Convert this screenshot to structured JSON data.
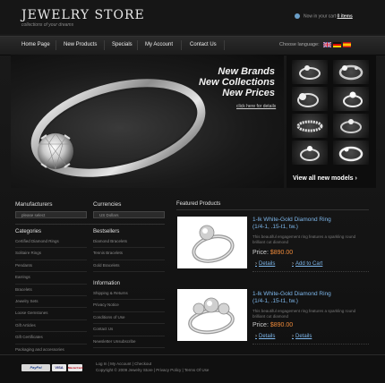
{
  "header": {
    "logo_title": "JEWELRY STORE",
    "logo_subtitle": "collections of your dreams",
    "cart_text": "Now in your cart ",
    "cart_items": "0 items"
  },
  "nav": {
    "items": [
      "Home Page",
      "New Products",
      "Specials",
      "My Account",
      "Contact Us"
    ],
    "language_label": "Choose language:",
    "flags": [
      "uk-flag-icon",
      "de-flag-icon",
      "es-flag-icon"
    ]
  },
  "banner": {
    "lines": [
      "New Brands",
      "New Collections",
      "New Prices"
    ],
    "link": "click here for details"
  },
  "gallery": {
    "view_all": "View all new models",
    "arrow": "›"
  },
  "sidebar": {
    "manufacturers": {
      "title": "Manufacturers",
      "select": "please select"
    },
    "currencies": {
      "title": "Currencies",
      "select": "US Dollars"
    },
    "categories": {
      "title": "Categories",
      "items": [
        "Certified Diamond Rings",
        "Solitaire Rings",
        "Pendants",
        "Earrings",
        "Bracelets",
        "Jewelry Sets",
        "Loose Gemstones",
        "Gift Articles",
        "Gift Certificates",
        "Packaging and accessories"
      ]
    },
    "bestsellers": {
      "title": "Bestsellers",
      "items": [
        "Diamond Bracelets",
        "Tennis Bracelets",
        "Gold Bracelets"
      ]
    },
    "information": {
      "title": "Information",
      "items": [
        "Shipping & Returns",
        "Privacy Notice",
        "Conditions of Use",
        "Contact Us",
        "Newsletter Unsubscribe"
      ]
    }
  },
  "products": {
    "title": "Featured Products",
    "items": [
      {
        "name_line1": "1-lk White-Gold Diamond Ring",
        "name_line2": "(1/4-1, .15-t1, tw.)",
        "desc": "This beautiful engagement ring features a sparkling round brilliant cut diamond",
        "price_label": "Price:",
        "price": "$890.00",
        "link1": "Details",
        "link2": "Add to Cart"
      },
      {
        "name_line1": "1-lk White-Gold Diamond Ring",
        "name_line2": "(1/4-1, .15-t1, tw.)",
        "desc": "This beautiful engagement ring features a sparkling round brilliant cut diamond",
        "price_label": "Price:",
        "price": "$890.00",
        "link1": "Details",
        "link2": "Details"
      }
    ]
  },
  "footer": {
    "payments": [
      "PayPal",
      "VISA",
      "MasterCard"
    ],
    "line1": "Log In  |  My Account  |  Checkout",
    "line2": "Copyright © 2009 Jewelry Store  |  Privacy Policy  |  Terms Of Use"
  },
  "colors": {
    "background": "#141414",
    "link": "#7db6ea",
    "price": "#ee8a3a",
    "text": "#bbbbbb"
  }
}
